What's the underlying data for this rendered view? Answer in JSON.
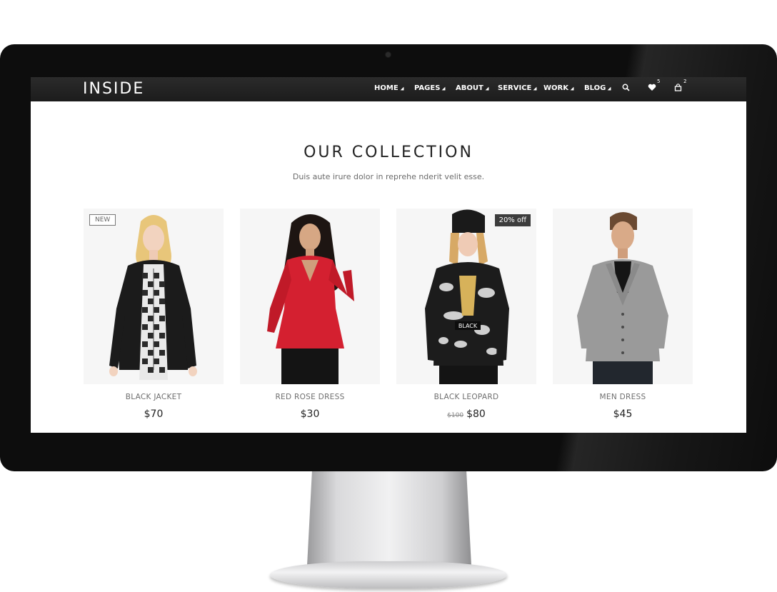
{
  "brand": "INSIDE",
  "nav": {
    "items": [
      {
        "label": "HOME"
      },
      {
        "label": "PAGES"
      },
      {
        "label": "ABOUT"
      },
      {
        "label": "SERVICE"
      },
      {
        "label": "WORK"
      },
      {
        "label": "BLOG"
      }
    ],
    "wishlist_count": "5",
    "cart_count": "2"
  },
  "section": {
    "title": "OUR COLLECTION",
    "subtitle": "Duis aute irure dolor in reprehe nderit velit esse."
  },
  "products": [
    {
      "name": "BLACK JACKET",
      "price": "$70",
      "tag": "NEW"
    },
    {
      "name": "RED ROSE DRESS",
      "price": "$30"
    },
    {
      "name": "BLACK LEOPARD",
      "old_price": "$100",
      "price": "$80",
      "tag": "20% off"
    },
    {
      "name": "MEN DRESS",
      "price": "$45"
    }
  ],
  "colors": {
    "navbar": "#222222",
    "bezel": "#0d0d0d",
    "tag_dark": "#3c3c3c",
    "red_dress": "#d42030"
  }
}
